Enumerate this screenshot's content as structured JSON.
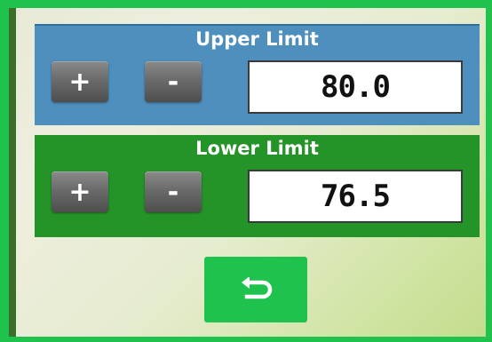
{
  "upper": {
    "title": "Upper Limit",
    "plus_label": "+",
    "minus_label": "-",
    "value": "80.0"
  },
  "lower": {
    "title": "Lower Limit",
    "plus_label": "+",
    "minus_label": "-",
    "value": "76.5"
  },
  "back_button": {
    "icon": "back-arrow-icon"
  },
  "colors": {
    "frame_border": "#1fc24c",
    "upper_panel": "#4f8fbd",
    "lower_panel": "#259428",
    "button": "#6b6b6b",
    "back_button": "#1fc24c"
  }
}
